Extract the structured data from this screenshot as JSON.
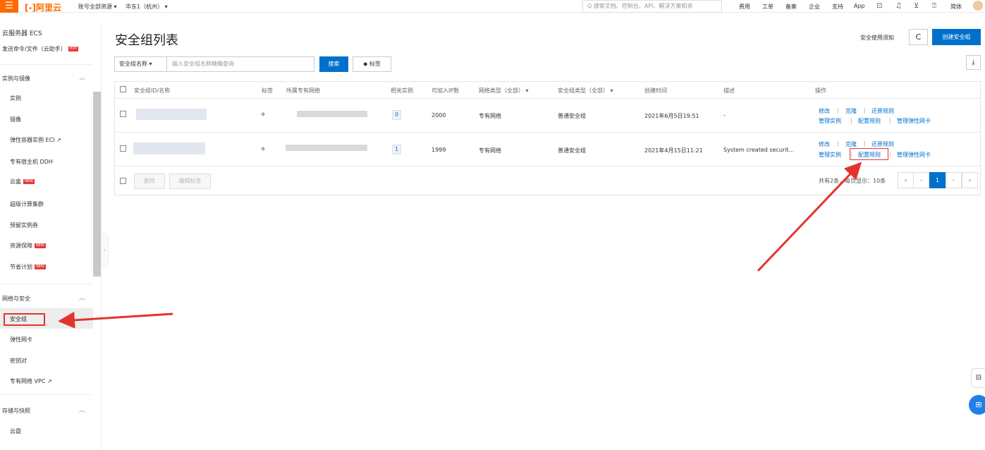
{
  "topbar": {
    "logo": "[-]阿里云",
    "account_scope": "账号全部资源 ▾",
    "region": "华东1（杭州） ▾",
    "search_placeholder": "Q 搜索文档、控制台、API、解决方案和资",
    "nav": [
      "费用",
      "工单",
      "备案",
      "企业",
      "支持",
      "App"
    ],
    "lang": "简体"
  },
  "sidebar": {
    "title": "云服务器 ECS",
    "subtitle": "发送命令/文件（云助手）",
    "hot_badge": "HOT",
    "new_badge": "NEW",
    "sections": [
      {
        "label": "实例与镜像",
        "items": [
          "实例",
          "镜像",
          "弹性容器实例 ECI ↗",
          "专有宿主机 DDH",
          "云盒",
          "超级计算集群",
          "预留实例券",
          "资源保障",
          "节省计划"
        ]
      },
      {
        "label": "网络与安全",
        "items": [
          "安全组",
          "弹性网卡",
          "密钥对",
          "专有网络 VPC ↗"
        ]
      },
      {
        "label": "存储与快照",
        "items": [
          "云盘"
        ]
      }
    ]
  },
  "page": {
    "title": "安全组列表",
    "help_link": "安全使用须知",
    "refresh_icon": "C",
    "create_button": "创建安全组",
    "filter_select": "安全组名称 ▾",
    "filter_placeholder": "输入安全组名称精确查询",
    "search_button": "搜索",
    "tag_button": "标签",
    "download_icon": "⤓"
  },
  "table": {
    "headers": [
      "安全组ID/名称",
      "标签",
      "所属专有网络",
      "相关实例",
      "可加入IP数",
      "网络类型（全部） ▾",
      "安全组类型（全部） ▾",
      "创建时间",
      "描述",
      "操作"
    ],
    "rows": [
      {
        "instances": "0",
        "ip_count": "2000",
        "network": "专有网络",
        "sg_type": "普通安全组",
        "created": "2021年6月5日19:51",
        "desc": "-"
      },
      {
        "instances": "1",
        "ip_count": "1999",
        "network": "专有网络",
        "sg_type": "普通安全组",
        "created": "2021年4月15日11:21",
        "desc": "System created securit..."
      }
    ],
    "actions": {
      "modify": "修改",
      "clone": "克隆",
      "restore": "还原规则",
      "manage_instances": "管理实例",
      "config_rules": "配置规则",
      "manage_eni": "管理弹性网卡"
    },
    "footer": {
      "delete": "删除",
      "edit_tags": "编辑标签",
      "summary": "共有2条，每页显示：10条",
      "page": "1",
      "first": "«",
      "prev": "‹",
      "next": "›",
      "last": "»"
    }
  },
  "colors": {
    "brand": "#ff6a00",
    "primary": "#0070cc",
    "annotation": "#e2342e"
  }
}
